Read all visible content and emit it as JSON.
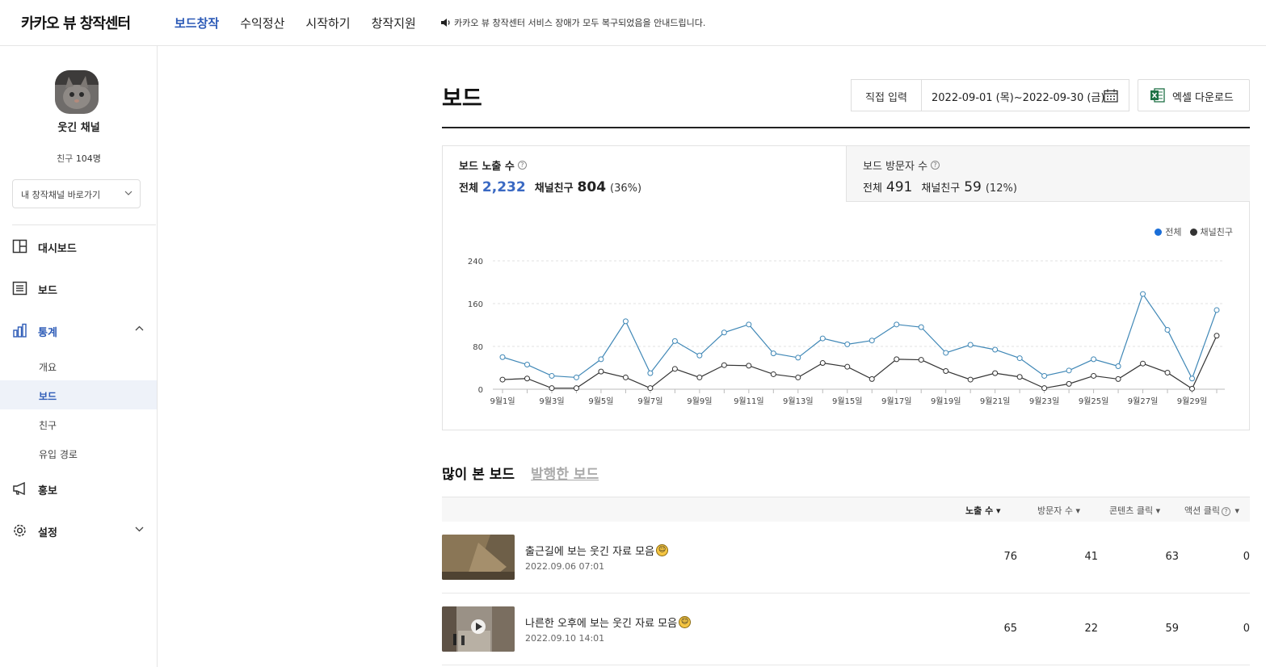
{
  "header": {
    "brand": "카카오 뷰 창작센터",
    "nav": [
      "보드창작",
      "수익정산",
      "시작하기",
      "창작지원"
    ],
    "notice": "카카오 뷰 창작센터 서비스 장애가 모두 복구되었음을 안내드립니다."
  },
  "sidebar": {
    "channel_name": "웃긴 채널",
    "friends_label": "친구",
    "friends_count": "104명",
    "channel_select": "내 창작채널 바로가기",
    "menu": {
      "dashboard": "대시보드",
      "board": "보드",
      "stats": "통계",
      "stats_sub": [
        "개요",
        "보드",
        "친구",
        "유입 경로"
      ],
      "promo": "홍보",
      "settings": "설정"
    }
  },
  "main": {
    "title": "보드",
    "direct_input": "직접 입력",
    "date_range": "2022-09-01 (목)~2022-09-30 (금)",
    "excel_download": "엑셀 다운로드"
  },
  "stats": {
    "exposure": {
      "title": "보드 노출 수",
      "total_label": "전체",
      "total": "2,232",
      "friends_label": "채널친구",
      "friends": "804",
      "pct": "(36%)"
    },
    "visitors": {
      "title": "보드 방문자 수",
      "total_label": "전체",
      "total": "491",
      "friends_label": "채널친구",
      "friends": "59",
      "pct": "(12%)"
    }
  },
  "colors": {
    "accent": "#2d5bb7",
    "series_total": "#3f87b6",
    "series_friends": "#333333"
  },
  "chart_data": {
    "type": "line",
    "x": [
      "9월1일",
      "9월2일",
      "9월3일",
      "9월4일",
      "9월5일",
      "9월6일",
      "9월7일",
      "9월8일",
      "9월9일",
      "9월10일",
      "9월11일",
      "9월12일",
      "9월13일",
      "9월14일",
      "9월15일",
      "9월16일",
      "9월17일",
      "9월18일",
      "9월19일",
      "9월20일",
      "9월21일",
      "9월22일",
      "9월23일",
      "9월24일",
      "9월25일",
      "9월26일",
      "9월27일",
      "9월28일",
      "9월29일",
      "9월30일"
    ],
    "x_tick_labels": [
      "9월1일",
      "9월3일",
      "9월5일",
      "9월7일",
      "9월9일",
      "9월11일",
      "9월13일",
      "9월15일",
      "9월17일",
      "9월19일",
      "9월21일",
      "9월23일",
      "9월25일",
      "9월27일",
      "9월29일"
    ],
    "y_ticks": [
      0,
      80,
      160,
      240
    ],
    "ylim": [
      0,
      240
    ],
    "legend": [
      "전체",
      "채널친구"
    ],
    "legend_position": "top-right",
    "grid": true,
    "series": [
      {
        "name": "전체",
        "values": [
          60,
          46,
          25,
          22,
          56,
          127,
          30,
          90,
          63,
          106,
          121,
          67,
          59,
          95,
          84,
          91,
          121,
          116,
          68,
          83,
          74,
          58,
          25,
          35,
          56,
          43,
          178,
          111,
          20,
          148
        ]
      },
      {
        "name": "채널친구",
        "values": [
          18,
          20,
          2,
          2,
          33,
          22,
          2,
          38,
          22,
          45,
          44,
          28,
          22,
          49,
          42,
          19,
          56,
          55,
          34,
          18,
          30,
          23,
          2,
          10,
          25,
          19,
          48,
          31,
          1,
          100
        ]
      }
    ]
  },
  "boards": {
    "tabs": [
      "많이 본 보드",
      "발행한 보드"
    ],
    "columns": [
      "노출 수",
      "방문자 수",
      "콘텐츠 클릭",
      "액션 클릭"
    ],
    "rows": [
      {
        "title": "출근길에 보는 웃긴 자료 모음",
        "date": "2022.09.06 07:01",
        "values": [
          "76",
          "41",
          "63",
          "0"
        ]
      },
      {
        "title": "나른한 오후에 보는 웃긴 자료 모음",
        "date": "2022.09.10 14:01",
        "values": [
          "65",
          "22",
          "59",
          "0"
        ]
      }
    ]
  }
}
